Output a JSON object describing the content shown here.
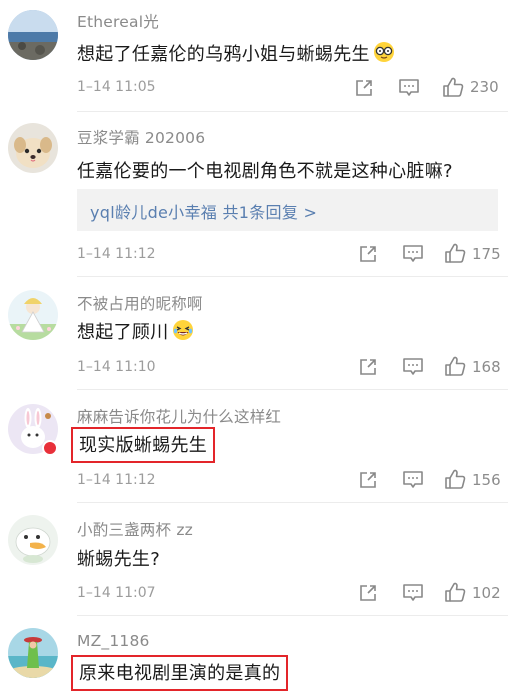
{
  "comments": [
    {
      "username": "Ethereal光",
      "text": "想起了任嘉伦的乌鸦小姐与蜥蜴先生",
      "emoji": "glasses-face-emoji",
      "time": "1–14 11:05",
      "likes": "230"
    },
    {
      "username": "豆浆学霸 202006",
      "text": "任嘉伦要的一个电视剧角色不就是这种心脏嘛?",
      "reply_link": "yql龄儿de小幸福 共1条回复 >",
      "time": "1–14 11:12",
      "likes": "175"
    },
    {
      "username": "不被占用的昵称啊",
      "text": "想起了顾川",
      "emoji": "laughing-face-emoji",
      "time": "1–14 11:10",
      "likes": "168"
    },
    {
      "username": "麻麻告诉你花儿为什么这样红",
      "text": "现实版蜥蜴先生",
      "time": "1–14 11:12",
      "likes": "156"
    },
    {
      "username": "小酌三盏两杯 zz",
      "text": "蜥蜴先生?",
      "time": "1–14 11:07",
      "likes": "102"
    },
    {
      "username": "MZ_1186",
      "text": "原来电视剧里演的是真的"
    }
  ],
  "colors": {
    "highlight_border": "#e3252a",
    "reply_link": "#5a7fb0",
    "username": "#8a8a8a",
    "meta": "#9c9c9c"
  },
  "icons": [
    "share-icon",
    "comment-icon",
    "like-icon"
  ]
}
